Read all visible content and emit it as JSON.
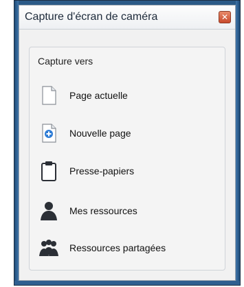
{
  "window": {
    "title": "Capture d'écran de caméra",
    "close_icon": "close-icon"
  },
  "group": {
    "label": "Capture vers",
    "items": [
      {
        "label": "Page actuelle",
        "icon": "page-icon"
      },
      {
        "label": "Nouvelle page",
        "icon": "new-page-icon"
      },
      {
        "label": "Presse-papiers",
        "icon": "clipboard-icon"
      },
      {
        "label": "Mes ressources",
        "icon": "person-icon"
      },
      {
        "label": "Ressources partagées",
        "icon": "people-icon"
      }
    ]
  },
  "colors": {
    "window_frame": "#2b5a87",
    "close_button": "#c84a2c"
  }
}
